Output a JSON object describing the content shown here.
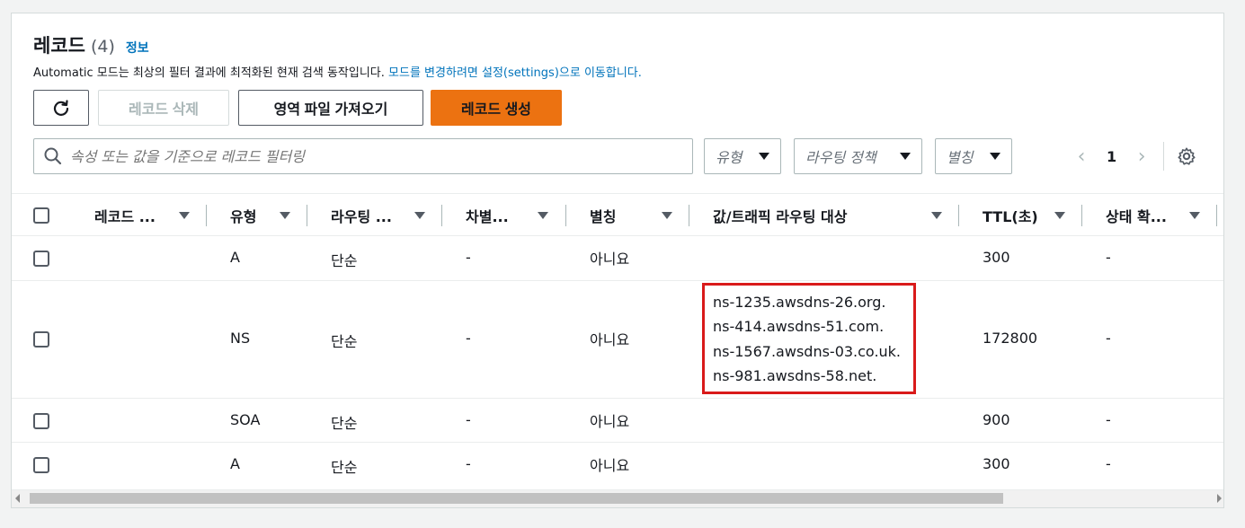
{
  "header": {
    "title": "레코드",
    "count": "(4)",
    "info_link": "정보",
    "description_prefix": "Automatic 모드는 최상의 필터 결과에 최적화된 현재 검색 동작입니다.",
    "description_link": "모드를 변경하려면 설정(settings)으로 이동합니다."
  },
  "toolbar": {
    "delete_label": "레코드 삭제",
    "import_label": "영역 파일 가져오기",
    "create_label": "레코드 생성"
  },
  "filters": {
    "search_placeholder": "속성 또는 값을 기준으로 레코드 필터링",
    "type_label": "유형",
    "routing_label": "라우팅 정책",
    "alias_label": "별칭"
  },
  "pagination": {
    "current_page": "1"
  },
  "table": {
    "columns": [
      "레코드 ...",
      "유형",
      "라우팅 ...",
      "차별...",
      "별칭",
      "값/트래픽 라우팅 대상",
      "TTL(초)",
      "상태 확..."
    ],
    "rows": [
      {
        "type": "A",
        "routing": "단순",
        "diff": "-",
        "alias": "아니요",
        "value": "",
        "ttl": "300",
        "health": "-"
      },
      {
        "type": "NS",
        "routing": "단순",
        "diff": "-",
        "alias": "아니요",
        "value": [
          "ns-1235.awsdns-26.org.",
          "ns-414.awsdns-51.com.",
          "ns-1567.awsdns-03.co.uk.",
          "ns-981.awsdns-58.net."
        ],
        "ttl": "172800",
        "health": "-"
      },
      {
        "type": "SOA",
        "routing": "단순",
        "diff": "-",
        "alias": "아니요",
        "value": "",
        "ttl": "900",
        "health": "-"
      },
      {
        "type": "A",
        "routing": "단순",
        "diff": "-",
        "alias": "아니요",
        "value": "",
        "ttl": "300",
        "health": "-"
      }
    ]
  },
  "colors": {
    "accent_link": "#0073bb",
    "primary_button": "#ec7211",
    "highlight_box": "#d91a1a"
  },
  "icons": {
    "refresh": "refresh-icon",
    "search": "search-icon",
    "settings": "gear-icon"
  }
}
